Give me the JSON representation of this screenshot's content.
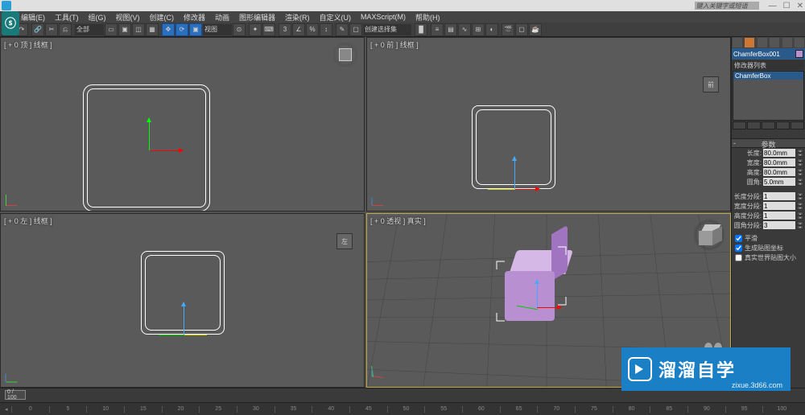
{
  "titlebar": {
    "search_placeholder": "键入关键字或短语"
  },
  "menu": [
    "编辑(E)",
    "工具(T)",
    "组(G)",
    "视图(V)",
    "创建(C)",
    "修改器",
    "动画",
    "图形编辑器",
    "渲染(R)",
    "自定义(U)",
    "MAXScript(M)",
    "帮助(H)"
  ],
  "toolbar": {
    "set_selector": "全部",
    "view_label": "视图",
    "input_placeholder": "创建选择集"
  },
  "viewports": {
    "top_left": "[ + 0 顶 ] 线框 ]",
    "top_right": "[ + 0 前 ] 线框 ]",
    "bottom_left": "[ + 0 左 ] 线框 ]",
    "bottom_right": "[ + 0 透视 ] 真实 ]"
  },
  "panel": {
    "object_name": "ChamferBox001",
    "modifier_label": "修改器列表",
    "stack_item": "ChamferBox",
    "section": "参数",
    "params": [
      {
        "label": "长度:",
        "value": "80.0mm"
      },
      {
        "label": "宽度:",
        "value": "80.0mm"
      },
      {
        "label": "高度:",
        "value": "80.0mm"
      },
      {
        "label": "圆角:",
        "value": "5.0mm"
      }
    ],
    "segs": [
      {
        "label": "长度分段:",
        "value": "1"
      },
      {
        "label": "宽度分段:",
        "value": "1"
      },
      {
        "label": "高度分段:",
        "value": "1"
      },
      {
        "label": "圆角分段:",
        "value": "3"
      }
    ],
    "checks": [
      {
        "label": "平滑",
        "checked": true
      },
      {
        "label": "生成贴图坐标",
        "checked": true
      },
      {
        "label": "真实世界贴图大小",
        "checked": false
      }
    ],
    "color_swatch": "#b88fd1"
  },
  "timeline": {
    "current": "0 / 100",
    "ticks": [
      "0",
      "5",
      "10",
      "15",
      "20",
      "25",
      "30",
      "35",
      "40",
      "45",
      "50",
      "55",
      "60",
      "65",
      "70",
      "75",
      "80",
      "85",
      "90",
      "95",
      "100"
    ]
  },
  "watermark": {
    "brand": "溜溜自学",
    "site": "zixue.3d66.com"
  }
}
